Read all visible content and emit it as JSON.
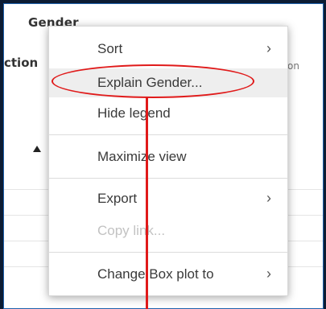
{
  "panel": {
    "title": "Gender",
    "col_left": "ction",
    "col_right": "on"
  },
  "menu": {
    "items": [
      {
        "label": "Sort",
        "submenu": true,
        "enabled": true
      },
      {
        "label": "Explain Gender...",
        "submenu": false,
        "enabled": true,
        "highlighted": true
      },
      {
        "label": "Hide legend",
        "submenu": false,
        "enabled": true
      },
      {
        "label": "Maximize view",
        "submenu": false,
        "enabled": true
      },
      {
        "label": "Export",
        "submenu": true,
        "enabled": true
      },
      {
        "label": "Copy link...",
        "submenu": false,
        "enabled": false
      },
      {
        "label": "Change Box plot to",
        "submenu": true,
        "enabled": true
      }
    ],
    "chevron": "›"
  },
  "annotation": {
    "color": "#e01a1a"
  }
}
